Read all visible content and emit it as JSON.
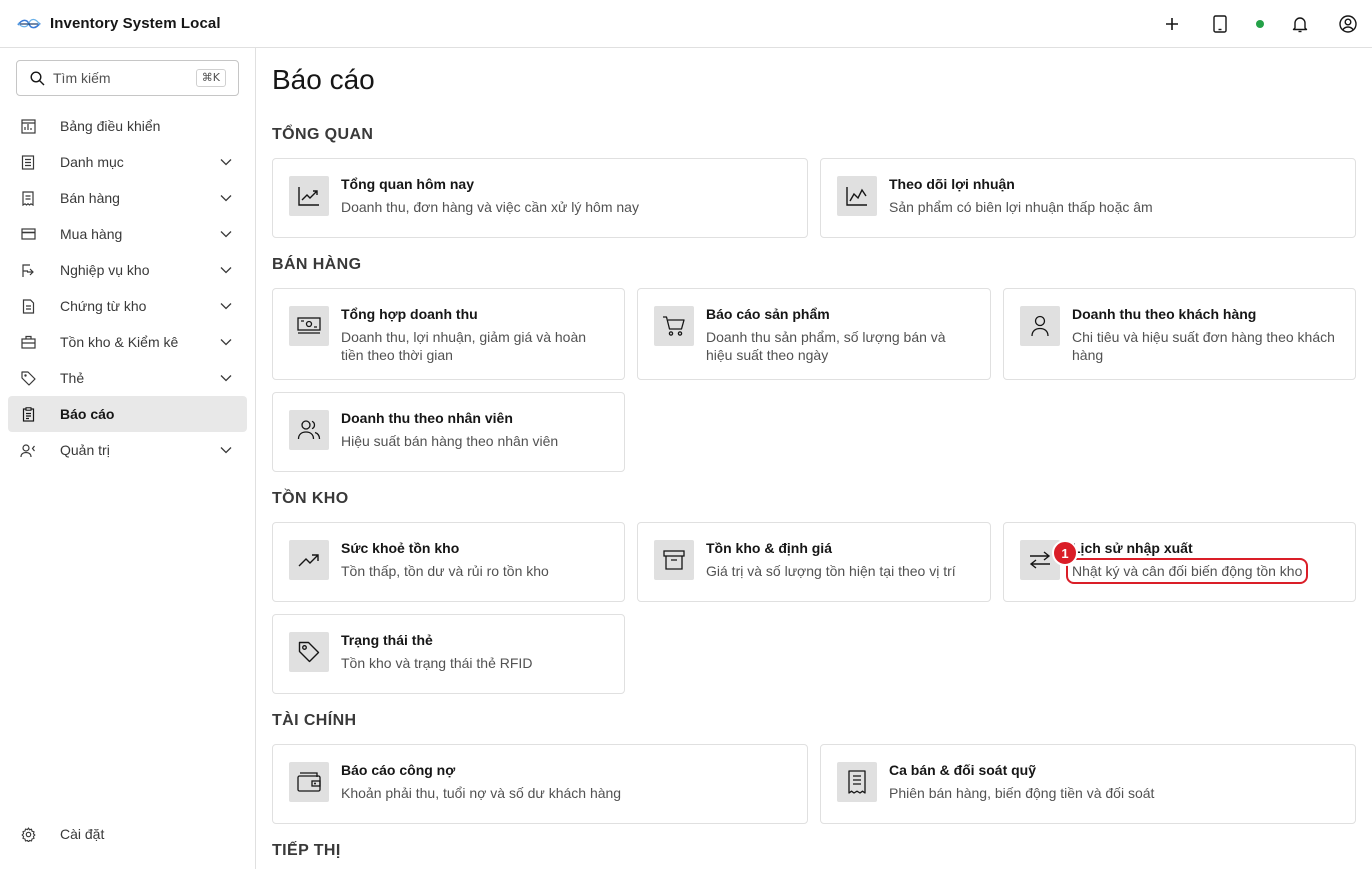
{
  "app": {
    "title": "Inventory System Local"
  },
  "search": {
    "placeholder": "Tìm kiếm",
    "shortcut": "⌘K"
  },
  "sidebar": {
    "items": [
      {
        "label": "Bảng điều khiển",
        "icon": "dashboard-icon",
        "expandable": false
      },
      {
        "label": "Danh mục",
        "icon": "catalog-icon",
        "expandable": true
      },
      {
        "label": "Bán hàng",
        "icon": "receipt-icon",
        "expandable": true
      },
      {
        "label": "Mua hàng",
        "icon": "card-icon",
        "expandable": true
      },
      {
        "label": "Nghiệp vụ kho",
        "icon": "warehouse-ops-icon",
        "expandable": true
      },
      {
        "label": "Chứng từ kho",
        "icon": "document-icon",
        "expandable": true
      },
      {
        "label": "Tồn kho & Kiểm kê",
        "icon": "inventory-icon",
        "expandable": true
      },
      {
        "label": "Thẻ",
        "icon": "tag-icon",
        "expandable": true
      },
      {
        "label": "Báo cáo",
        "icon": "report-icon",
        "expandable": false,
        "active": true
      },
      {
        "label": "Quản trị",
        "icon": "admin-icon",
        "expandable": true
      }
    ],
    "settings": "Cài đặt"
  },
  "main": {
    "title": "Báo cáo",
    "sections": [
      {
        "title": "TỔNG QUAN"
      },
      {
        "title": "BÁN HÀNG"
      },
      {
        "title": "TỒN KHO"
      },
      {
        "title": "TÀI CHÍNH"
      },
      {
        "title": "TIẾP THỊ"
      }
    ],
    "cards": [
      {
        "title": "Tổng quan hôm nay",
        "desc": "Doanh thu, đơn hàng và việc cần xử lý hôm nay",
        "icon": "chart-up-icon"
      },
      {
        "title": "Theo dõi lợi nhuận",
        "desc": "Sản phẩm có biên lợi nhuận thấp hoặc âm",
        "icon": "line-chart-icon"
      },
      {
        "title": "Tổng hợp doanh thu",
        "desc": "Doanh thu, lợi nhuận, giảm giá và hoàn tiền theo thời gian",
        "icon": "cash-icon"
      },
      {
        "title": "Báo cáo sản phẩm",
        "desc": "Doanh thu sản phẩm, số lượng bán và hiệu suất theo ngày",
        "icon": "cart-icon"
      },
      {
        "title": "Doanh thu theo khách hàng",
        "desc": "Chi tiêu và hiệu suất đơn hàng theo khách hàng",
        "icon": "user-icon"
      },
      {
        "title": "Doanh thu theo nhân viên",
        "desc": "Hiệu suất bán hàng theo nhân viên",
        "icon": "users-icon"
      },
      {
        "title": "Sức khoẻ tồn kho",
        "desc": "Tồn thấp, tồn dư và rủi ro tồn kho",
        "icon": "trend-up-icon"
      },
      {
        "title": "Tồn kho & định giá",
        "desc": "Giá trị và số lượng tồn hiện tại theo vị trí",
        "icon": "archive-icon"
      },
      {
        "title": "Lịch sử nhập xuất",
        "desc": "Nhật ký và cân đối biến động tồn kho",
        "icon": "arrows-exchange-icon"
      },
      {
        "title": "Trạng thái thẻ",
        "desc": "Tồn kho và trạng thái thẻ RFID",
        "icon": "tag-icon"
      },
      {
        "title": "Báo cáo công nợ",
        "desc": "Khoản phải thu, tuổi nợ và số dư khách hàng",
        "icon": "wallet-icon"
      },
      {
        "title": "Ca bán & đối soát quỹ",
        "desc": "Phiên bán hàng, biến động tiền và đối soát",
        "icon": "receipt-icon"
      }
    ]
  },
  "annotation": {
    "badge": "1"
  },
  "colors": {
    "accent": "#da1e28",
    "online": "#24a148",
    "active_bg": "#e8e8e8",
    "border": "#e0e0e0"
  }
}
